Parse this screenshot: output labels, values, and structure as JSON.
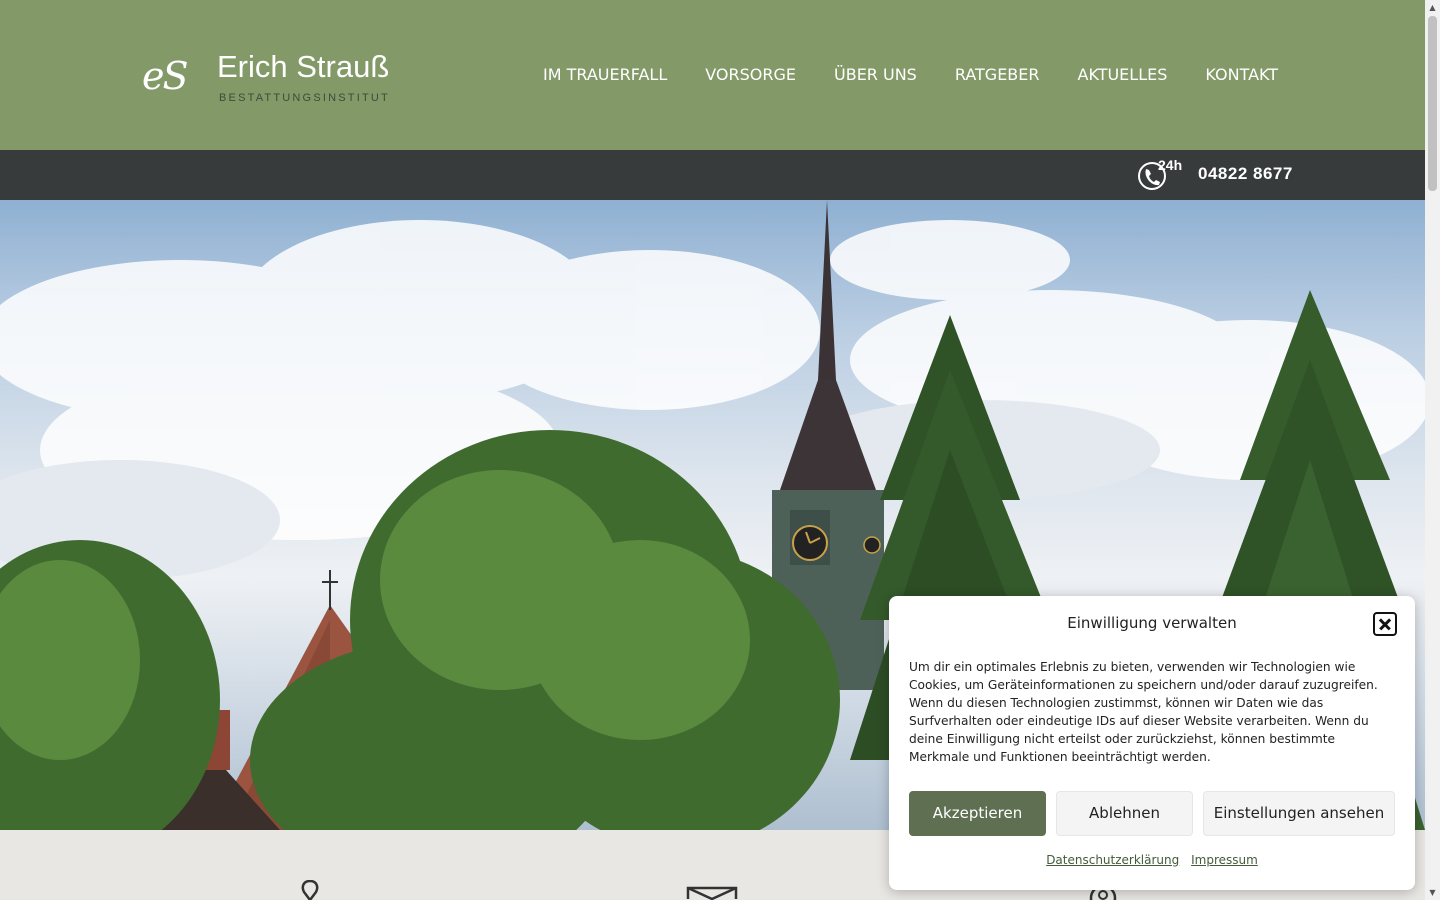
{
  "brand": {
    "mark": "eS",
    "name": "Erich Strauß",
    "subtitle": "BESTATTUNGSINSTITUT"
  },
  "nav": {
    "items": [
      {
        "label": "IM TRAUERFALL"
      },
      {
        "label": "VORSORGE"
      },
      {
        "label": "ÜBER UNS"
      },
      {
        "label": "RATGEBER"
      },
      {
        "label": "AKTUELLES"
      },
      {
        "label": "KONTAKT"
      }
    ]
  },
  "phonebar": {
    "badge": "24h",
    "number": "04822 8677",
    "icon": "phone-24h-icon"
  },
  "hero": {
    "image": "church-tower-trees-sky"
  },
  "lower": {
    "icons": [
      "location-pin-icon",
      "envelope-icon",
      "contact-icon"
    ]
  },
  "consent": {
    "title": "Einwilligung verwalten",
    "text": "Um dir ein optimales Erlebnis zu bieten, verwenden wir Technologien wie Cookies, um Geräteinformationen zu speichern und/oder darauf zuzugreifen. Wenn du diesen Technologien zustimmst, können wir Daten wie das Surfverhalten oder eindeutige IDs auf dieser Website verarbeiten. Wenn du deine Einwilligung nicht erteilst oder zurückziehst, können bestimmte Merkmale und Funktionen beeinträchtigt werden.",
    "accept_label": "Akzeptieren",
    "decline_label": "Ablehnen",
    "settings_label": "Einstellungen ansehen",
    "privacy_link": "Datenschutzerklärung",
    "imprint_link": "Impressum"
  },
  "colors": {
    "header_green": "#839a68",
    "bar_dark": "#373b3b",
    "accept_green": "#5e6f52",
    "page_bg": "#e9e7e3"
  }
}
